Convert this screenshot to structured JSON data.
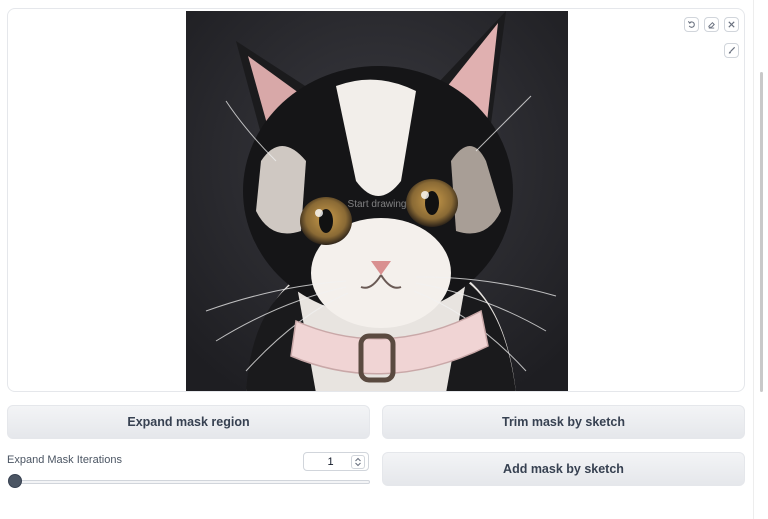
{
  "canvas": {
    "hint": "Start drawing",
    "image_subject": "cat-portrait-with-collar",
    "tools": [
      "undo-icon",
      "eraser-icon",
      "close-icon",
      "brush-icon"
    ]
  },
  "buttons": {
    "expand": "Expand mask region",
    "trim": "Trim mask by sketch",
    "add": "Add mask by sketch"
  },
  "expand_iterations": {
    "label": "Expand Mask Iterations",
    "value": "1",
    "slider_fraction": 0.0
  },
  "colors": {
    "button_bg": "#e5e7eb",
    "slider_thumb": "#4b5563",
    "border": "#e5e7eb"
  }
}
